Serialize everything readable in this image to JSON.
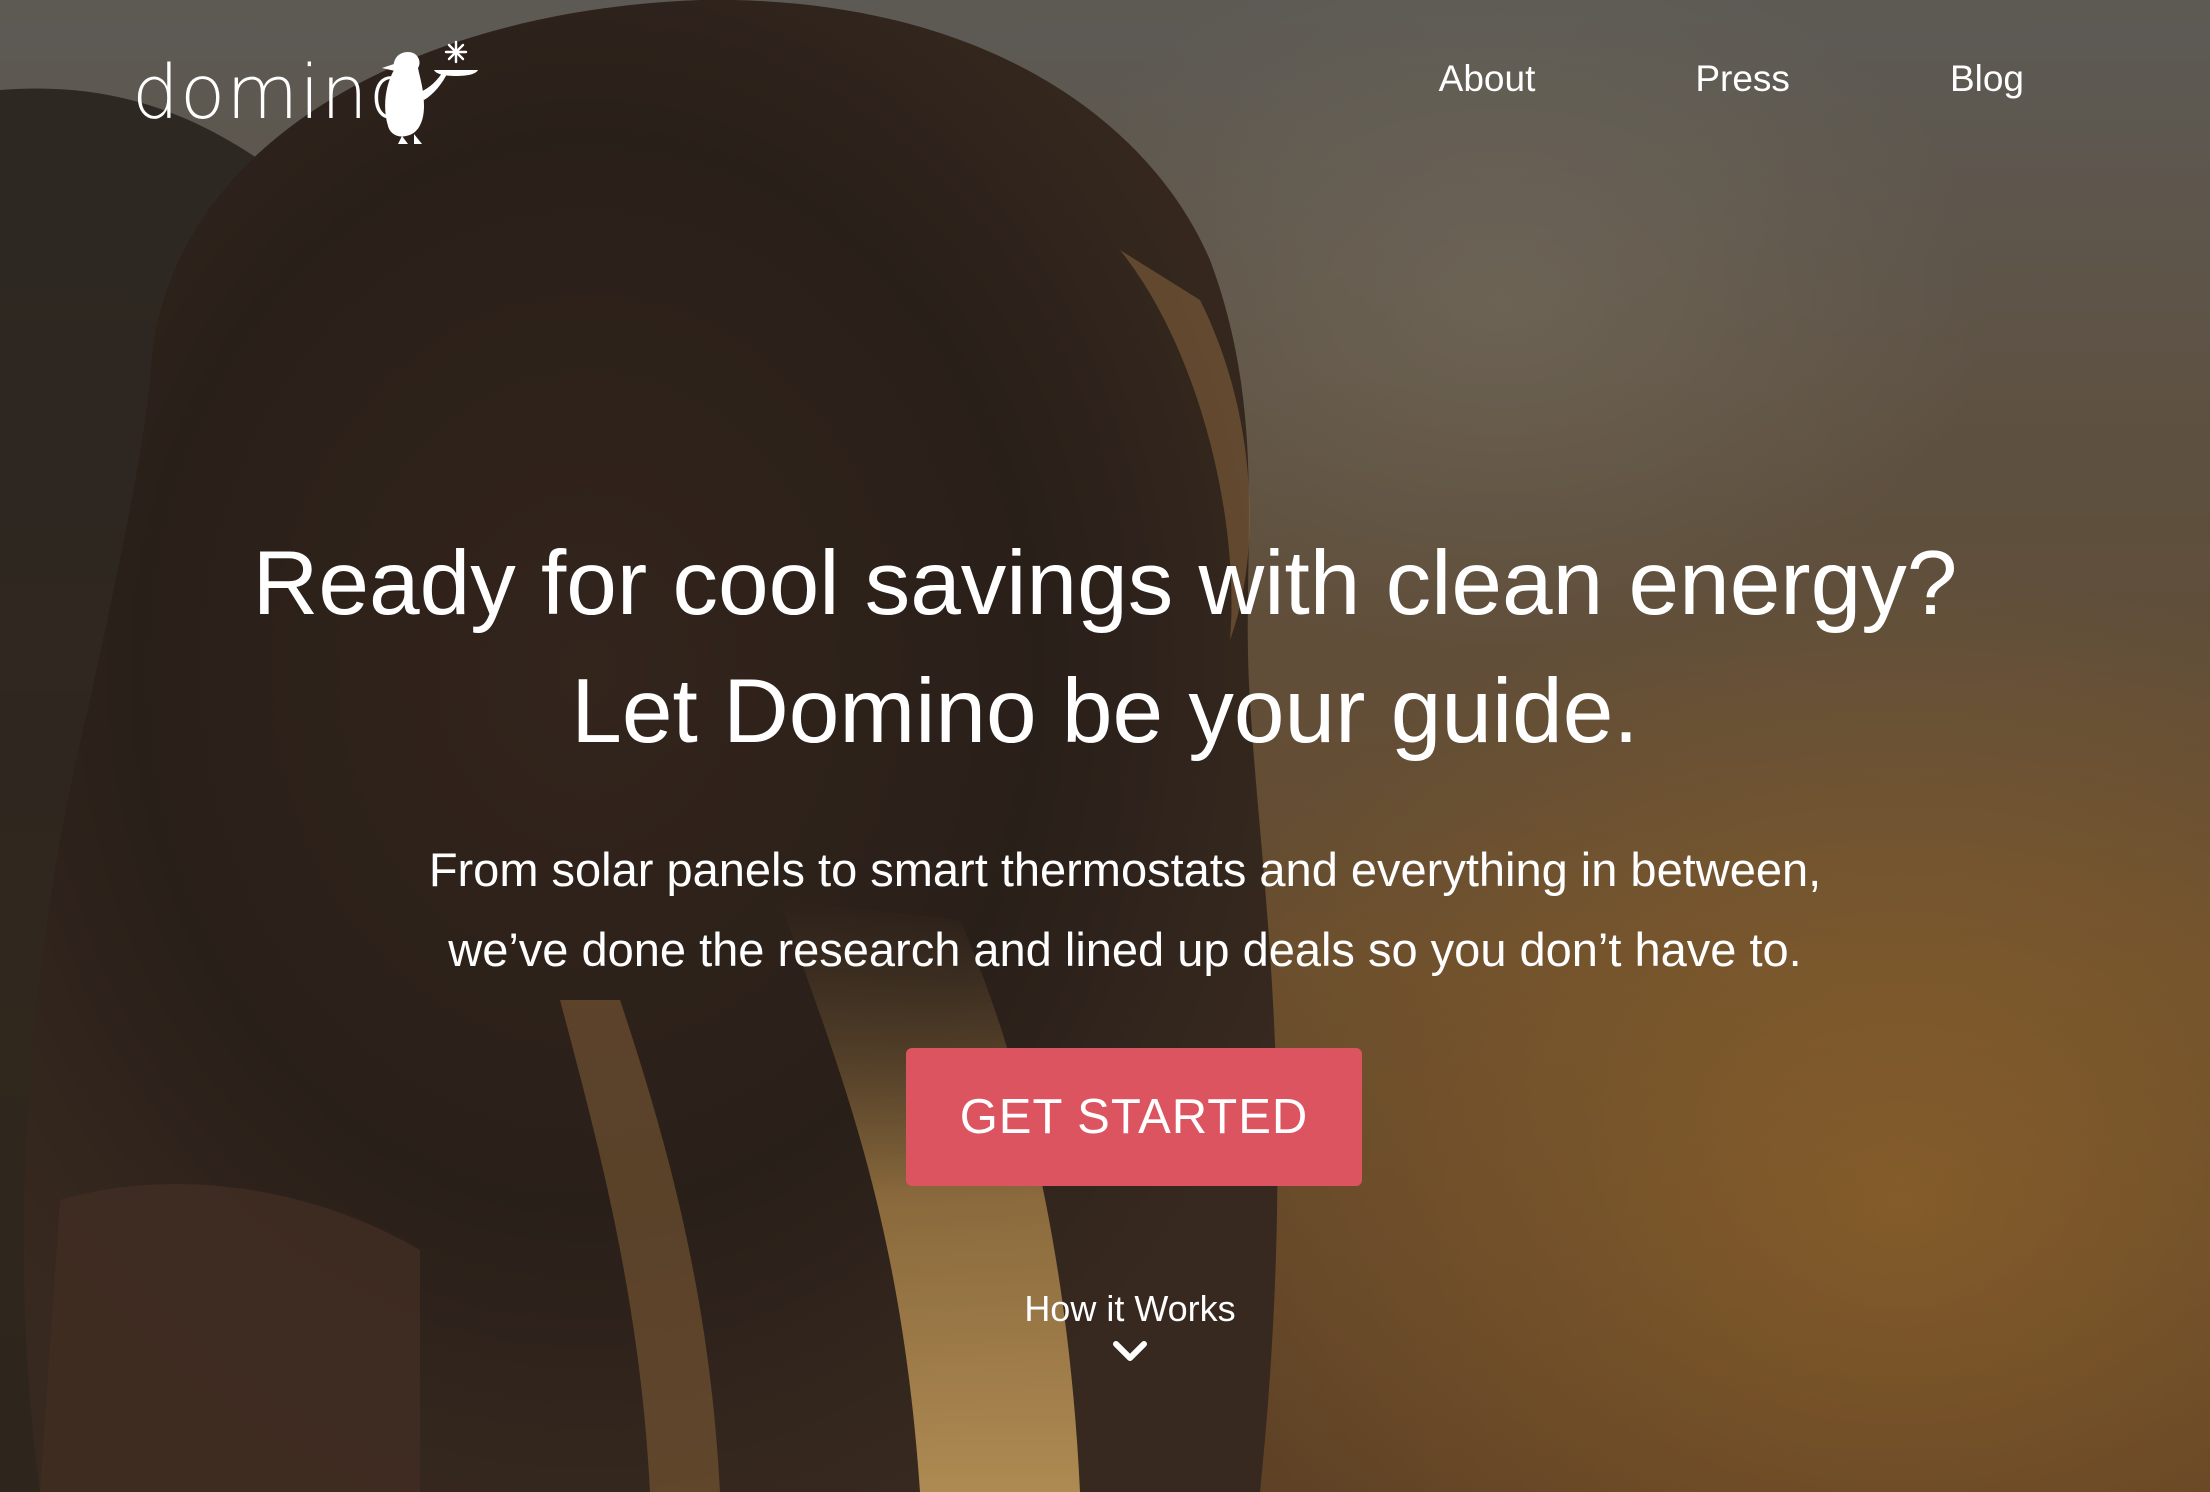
{
  "brand": {
    "logo_text": "domino"
  },
  "nav": {
    "links": [
      {
        "label": "About"
      },
      {
        "label": "Press"
      },
      {
        "label": "Blog"
      }
    ]
  },
  "hero": {
    "headline_line1": "Ready for cool savings with clean energy?",
    "headline_line2": "Let Domino be your guide.",
    "subtext_line1": "From solar panels to smart thermostats and everything in between,",
    "subtext_line2": "we’ve done the research and lined up deals so you don’t have to.",
    "cta_label": "GET STARTED",
    "how_it_works_label": "How it Works"
  },
  "icons": {
    "logo_mark": "penguin-waiter-icon",
    "scroll": "chevron-down-icon"
  },
  "colors": {
    "cta_background": "#dc5460",
    "text": "#ffffff"
  }
}
